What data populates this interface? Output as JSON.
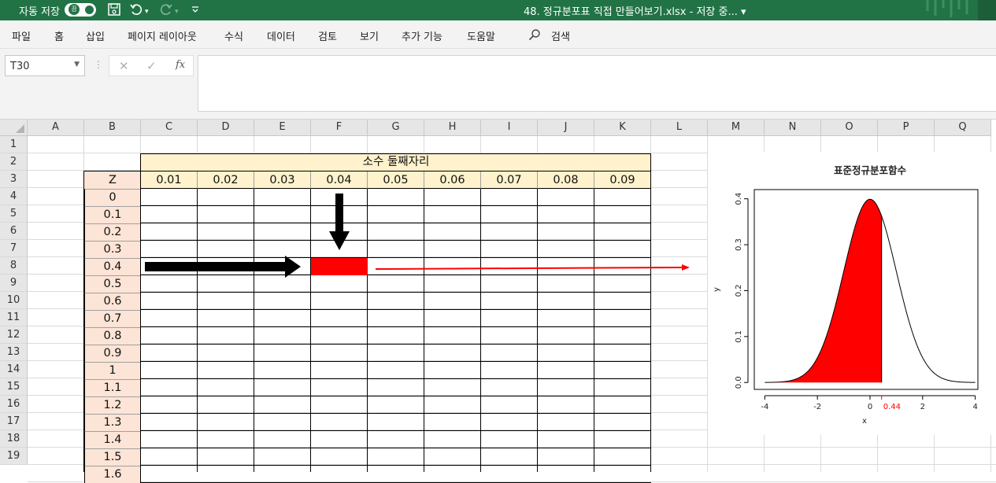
{
  "titlebar": {
    "autosave_label": "자동 저장",
    "autosave_state": "끔",
    "document_title": "48. 정규분포표 직접 만들어보기.xlsx  -  저장 중...  ▾"
  },
  "ribbon": {
    "tabs": [
      "파일",
      "홈",
      "삽입",
      "페이지 레이아웃",
      "수식",
      "데이터",
      "검토",
      "보기",
      "추가 기능",
      "도움말"
    ],
    "search_label": "검색"
  },
  "formula_bar": {
    "name_box": "T30",
    "formula_value": ""
  },
  "columns": [
    "A",
    "B",
    "C",
    "D",
    "E",
    "F",
    "G",
    "H",
    "I",
    "J",
    "K",
    "L",
    "M",
    "N",
    "O",
    "P",
    "Q"
  ],
  "rows": [
    "1",
    "2",
    "3",
    "4",
    "5",
    "6",
    "7",
    "8",
    "9",
    "10",
    "11",
    "12",
    "13",
    "14",
    "15",
    "16",
    "17",
    "18",
    "19"
  ],
  "table": {
    "merged_title": "소수 둘째자리",
    "z_header": "Z",
    "decimal_headers": [
      "0.01",
      "0.02",
      "0.03",
      "0.04",
      "0.05",
      "0.06",
      "0.07",
      "0.08",
      "0.09"
    ],
    "z_values": [
      "0",
      "0.1",
      "0.2",
      "0.3",
      "0.4",
      "0.5",
      "0.6",
      "0.7",
      "0.8",
      "0.9",
      "1",
      "1.1",
      "1.2",
      "1.3",
      "1.4",
      "1.5",
      "1.6"
    ],
    "highlight_color": "#ff0000"
  },
  "chart_data": {
    "type": "area",
    "title": "표준정규분포함수",
    "xlabel": "x",
    "ylabel": "y",
    "xlim": [
      -4.4,
      4.1
    ],
    "ylim": [
      -0.015,
      0.42
    ],
    "xticks": [
      "-4",
      "-2",
      "0",
      "2",
      "4"
    ],
    "xtick_values": [
      -4,
      -2,
      0,
      2,
      4
    ],
    "yticks": [
      "0.0",
      "0.1",
      "0.2",
      "0.3",
      "0.4"
    ],
    "ytick_values": [
      0.0,
      0.1,
      0.2,
      0.3,
      0.4
    ],
    "curve_range": [
      -4,
      4
    ],
    "shaded_upto": 0.44,
    "marker_label": "0.44",
    "fill_color": "#ff0000",
    "marker_color": "#ff0000"
  }
}
